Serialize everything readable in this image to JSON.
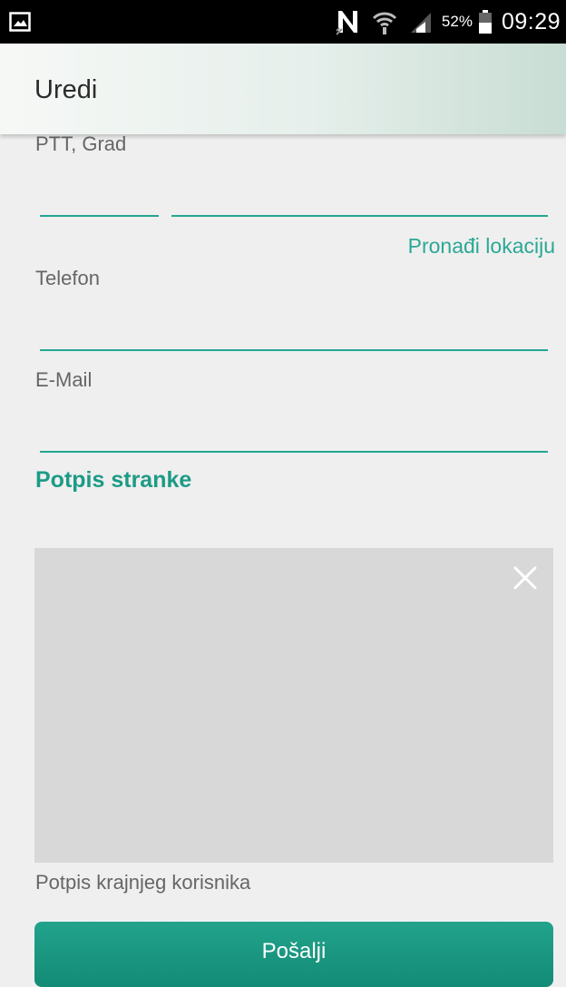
{
  "status_bar": {
    "battery_percent": "52%",
    "time": "09:29",
    "icons": [
      "gallery-icon",
      "nfc-icon",
      "wifi-icon",
      "signal-icon",
      "battery-icon"
    ]
  },
  "app_bar": {
    "title": "Uredi"
  },
  "form": {
    "ptt_label": "PTT, Grad",
    "ptt_value": "",
    "city_value": "",
    "find_location_link": "Pronađi lokaciju",
    "phone_label": "Telefon",
    "phone_value": "",
    "email_label": "E-Mail",
    "email_value": ""
  },
  "signature": {
    "section_title": "Potpis stranke",
    "clear_icon": "close-icon",
    "caption": "Potpis krajnjeg korisnika"
  },
  "actions": {
    "send_label": "Pošalji"
  },
  "colors": {
    "accent": "#23a691",
    "button": "#138b76",
    "background": "#efefef",
    "signature_pad": "#d8d8d8"
  }
}
